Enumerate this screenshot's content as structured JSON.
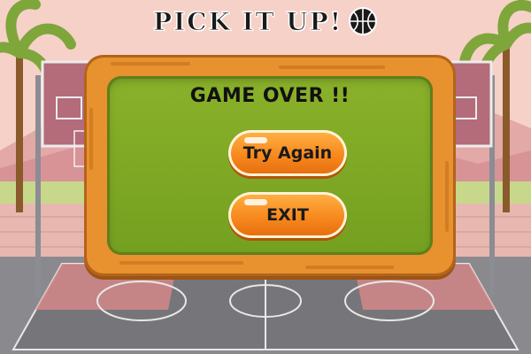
{
  "game": {
    "title": "PICK IT UP!",
    "title_icon": "basketball-icon"
  },
  "dialog": {
    "heading": "GAME OVER !!",
    "try_again_label": "Try Again",
    "exit_label": "EXIT"
  },
  "colors": {
    "wood_frame": "#e8912f",
    "panel_green": "#7fa726",
    "button_orange": "#f7891e",
    "court_gray": "#8a8a8e",
    "court_red": "#d98a8a"
  }
}
